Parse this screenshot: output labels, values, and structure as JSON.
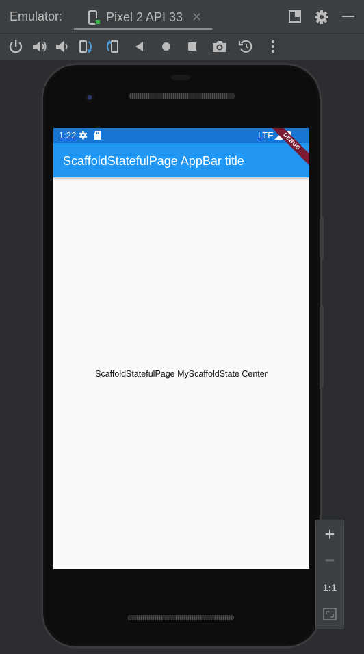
{
  "window": {
    "label": "Emulator:",
    "tab_label": "Pixel 2 API 33",
    "tab_close": "✕"
  },
  "toolbar": {
    "buttons": [
      "power-icon",
      "volume-up-icon",
      "volume-down-icon",
      "rotate-left-icon",
      "rotate-right-icon",
      "back-icon",
      "home-icon",
      "overview-icon",
      "screenshot-icon",
      "snapshot-icon",
      "more-icon"
    ]
  },
  "device": {
    "status_time": "1:22",
    "status_network": "LTE",
    "debug_label": "DEBUG"
  },
  "app": {
    "appbar_title": "ScaffoldStatefulPage AppBar title",
    "center_text": "ScaffoldStatefulPage MyScaffoldState Center"
  },
  "zoom": {
    "zoom_in": "+",
    "zoom_out": "−",
    "actual_size": "1:1"
  },
  "colors": {
    "statusbar": "#1976d2",
    "appbar": "#2196f3",
    "debug_banner": "#7a1b34",
    "ide_background": "#2b2d30"
  }
}
